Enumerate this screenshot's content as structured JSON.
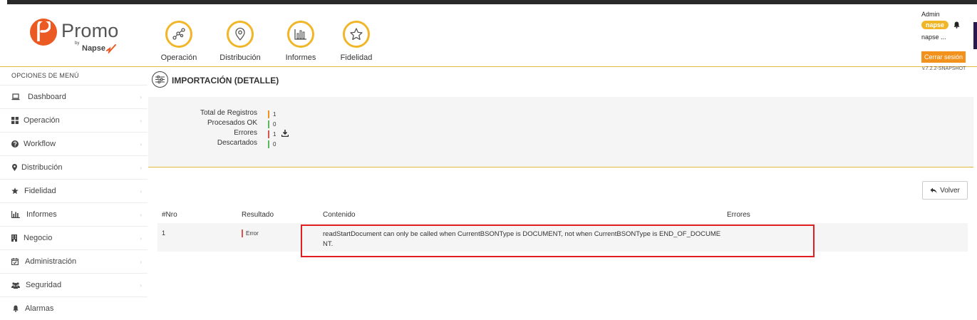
{
  "brand": {
    "logo_letter": "p",
    "name": "Promo",
    "by": "by",
    "company": "Napse",
    "primary_color": "#ec5a24",
    "accent_color": "#f0b627"
  },
  "nav": [
    {
      "label": "Operación",
      "icon": "operation-graph-icon"
    },
    {
      "label": "Distribución",
      "icon": "map-pin-icon"
    },
    {
      "label": "Informes",
      "icon": "bar-chart-icon"
    },
    {
      "label": "Fidelidad",
      "icon": "star-icon"
    }
  ],
  "user": {
    "name": "Admin",
    "badge": "napse",
    "org": "napse ...",
    "logout_label": "Cerrar sesión",
    "version": "v.7.2.2-SNAPSHOT"
  },
  "sidebar": {
    "title": "OPCIONES DE MENÚ",
    "items": [
      {
        "label": "Dashboard",
        "icon": "laptop-icon"
      },
      {
        "label": "Operación",
        "icon": "grid-icon"
      },
      {
        "label": "Workflow",
        "icon": "question-circle-icon"
      },
      {
        "label": "Distribución",
        "icon": "map-marker-icon"
      },
      {
        "label": "Fidelidad",
        "icon": "star-icon"
      },
      {
        "label": "Informes",
        "icon": "bar-chart-icon"
      },
      {
        "label": "Negocio",
        "icon": "building-icon"
      },
      {
        "label": "Administración",
        "icon": "calendar-check-icon"
      },
      {
        "label": "Seguridad",
        "icon": "users-icon"
      },
      {
        "label": "Alarmas",
        "icon": "bell-icon"
      }
    ]
  },
  "page": {
    "title": "IMPORTACIÓN (DETALLE)"
  },
  "summary": {
    "total_label": "Total de Registros",
    "total_value": "1",
    "ok_label": "Procesados OK",
    "ok_value": "0",
    "errors_label": "Errores",
    "errors_value": "1",
    "discarded_label": "Descartados",
    "discarded_value": "0"
  },
  "back_button": "Volver",
  "table": {
    "columns": [
      "#Nro",
      "Resultado",
      "Contenido",
      "Errores"
    ],
    "rows": [
      {
        "nro": "1",
        "result": "Error",
        "content": "readStartDocument can only be called when CurrentBSONType is DOCUMENT, not when CurrentBSONType is END_OF_DOCUMENT.",
        "errors": ""
      }
    ]
  },
  "colors": {
    "status_ok": "#5cb85c",
    "status_error": "#d9534f",
    "status_total": "#f2921d",
    "highlight": "#e02020"
  }
}
